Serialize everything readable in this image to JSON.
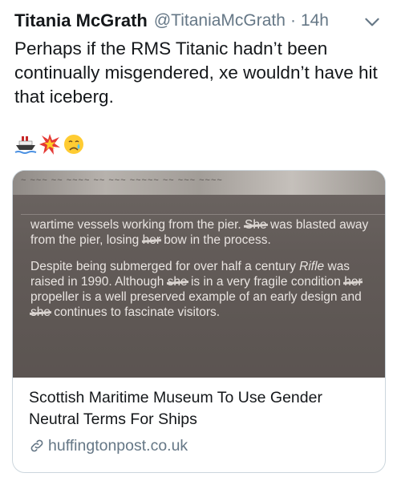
{
  "tweet": {
    "author_name": "Titania McGrath",
    "handle": "@TitaniaMcGrath",
    "separator": "·",
    "time": "14h",
    "text": "Perhaps if the RMS Titanic hadn’t been continually misgendered, xe wouldn’t have hit that iceberg.",
    "emojis": [
      "ship-emoji",
      "collision-emoji",
      "crying-face-emoji"
    ]
  },
  "card": {
    "image": {
      "para1": {
        "a": "wartime vessels working from the pier. ",
        "b": "She",
        "c": " was blasted away from the pier, losing ",
        "d": "her",
        "e": " bow in the process."
      },
      "para2": {
        "a": "Despite being submerged for over half a century ",
        "b": "Rifle",
        "c": " was raised in 1990. Although ",
        "d": "she",
        "e": " is in a very fragile condition ",
        "f": "her",
        "g": " propeller is a well preserved example of an early design and ",
        "h": "she",
        "i": " continues to fascinate visitors."
      }
    },
    "title": "Scottish Maritime Museum To Use Gender Neutral Terms For Ships",
    "domain": "huffingtonpost.co.uk"
  },
  "colors": {
    "text": "#14171a",
    "secondary": "#657786",
    "border": "#ccd6dd"
  }
}
